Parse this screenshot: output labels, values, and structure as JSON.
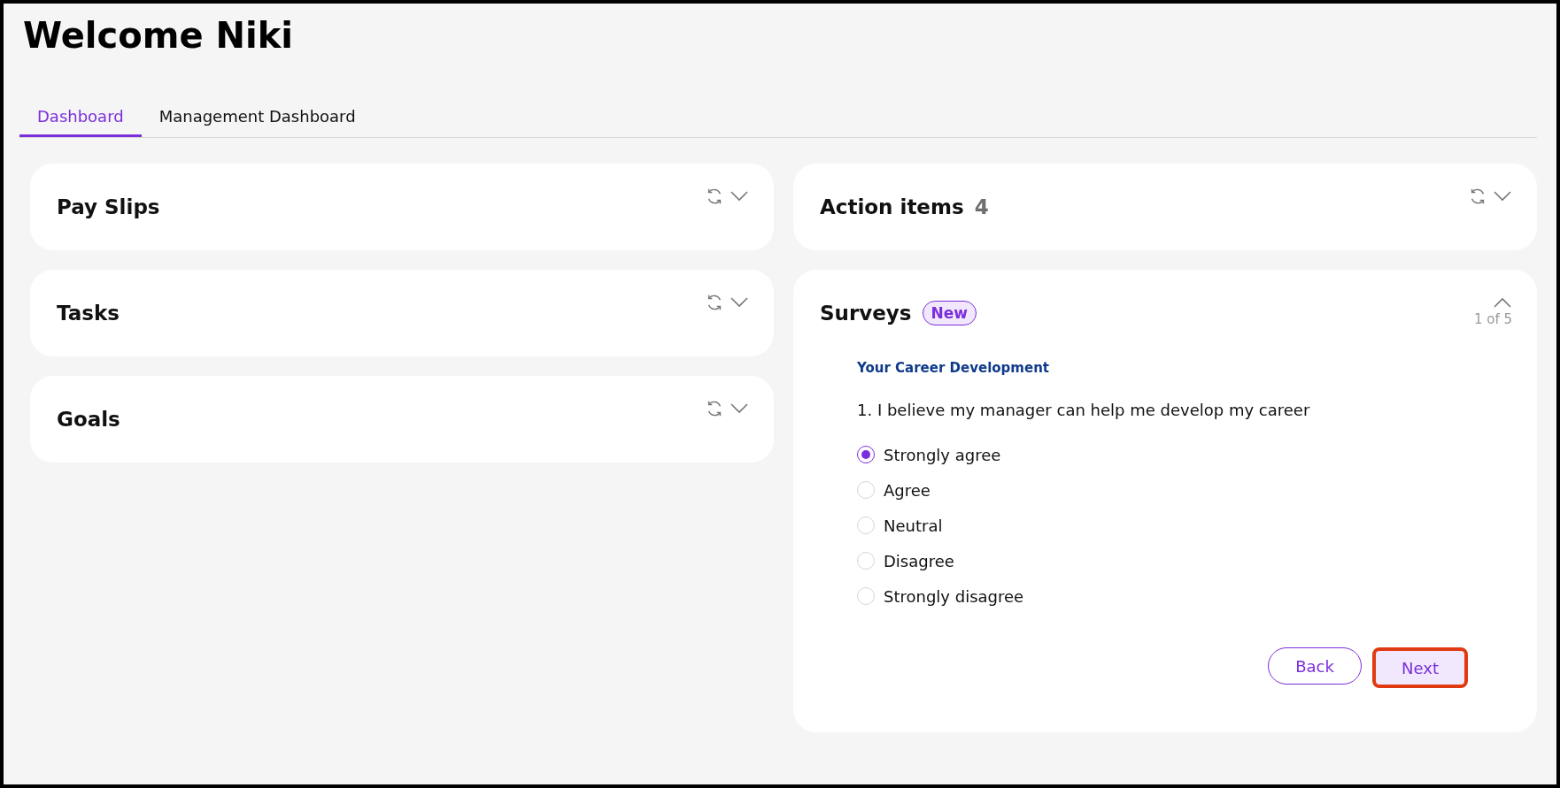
{
  "page_title": "Welcome Niki",
  "tabs": [
    {
      "label": "Dashboard",
      "selected": true
    },
    {
      "label": "Management Dashboard",
      "selected": false
    }
  ],
  "left_cards": [
    {
      "title": "Pay Slips",
      "expanded": false
    },
    {
      "title": "Tasks",
      "expanded": false
    },
    {
      "title": "Goals",
      "expanded": false
    }
  ],
  "action_items": {
    "title": "Action items",
    "count": "4",
    "expanded": false
  },
  "surveys": {
    "title": "Surveys",
    "badge": "New",
    "expanded": true,
    "pager": "1 of 5",
    "section": "Your Career Development",
    "question": "1. I believe my manager can help me develop my career",
    "options": [
      {
        "label": "Strongly agree",
        "selected": true
      },
      {
        "label": "Agree",
        "selected": false
      },
      {
        "label": "Neutral",
        "selected": false
      },
      {
        "label": "Disagree",
        "selected": false
      },
      {
        "label": "Strongly disagree",
        "selected": false
      }
    ],
    "buttons": [
      {
        "label": "Back",
        "kind": "outline",
        "highlighted": false
      },
      {
        "label": "Next",
        "kind": "filled",
        "highlighted": true
      }
    ]
  }
}
